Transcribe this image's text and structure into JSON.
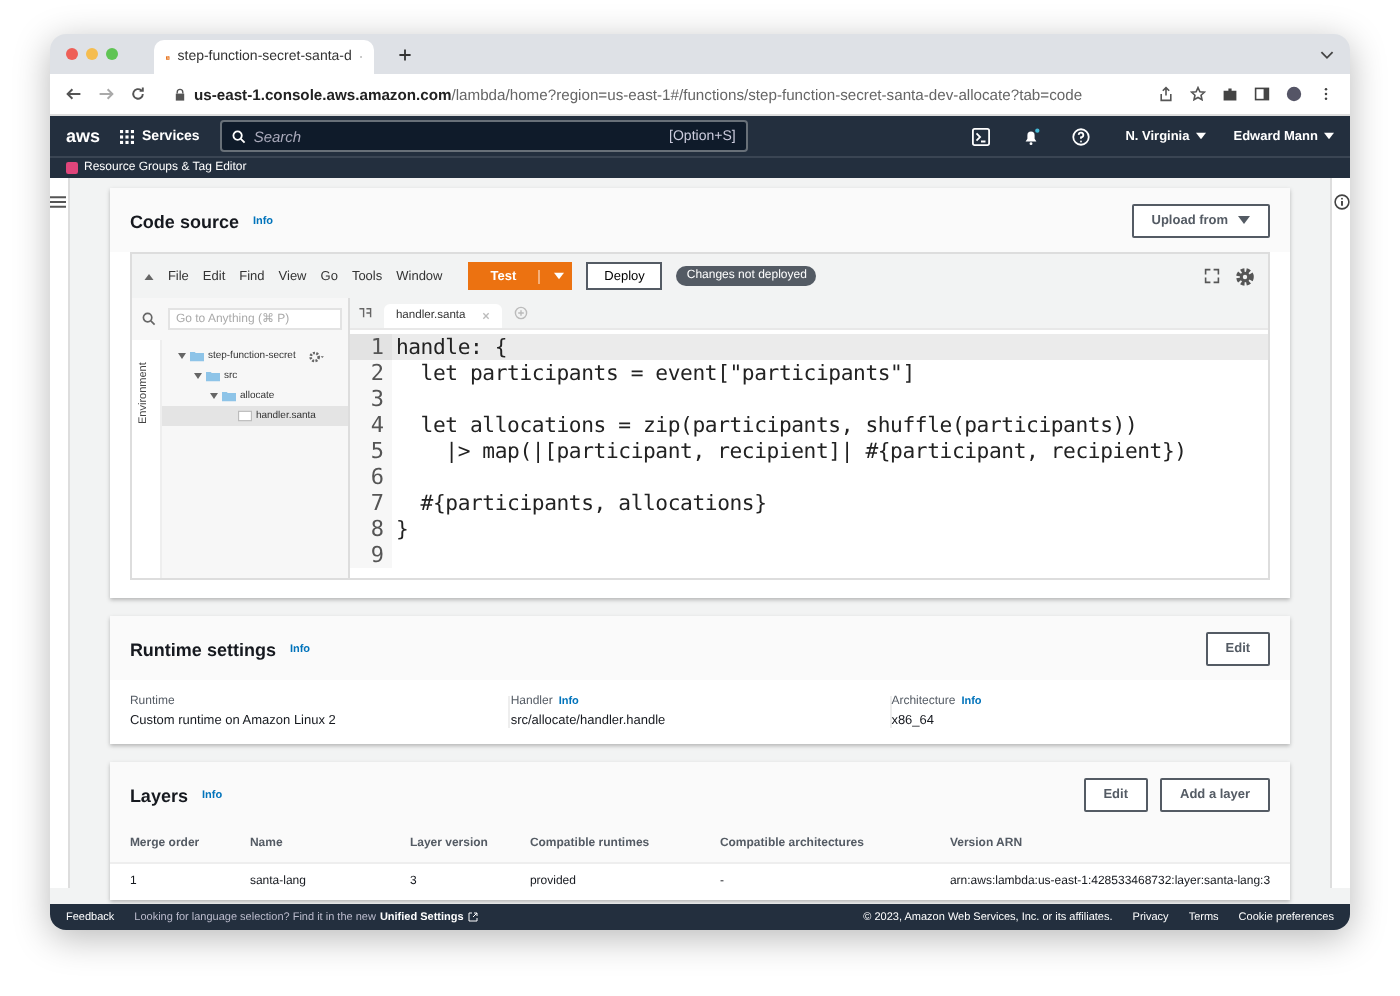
{
  "browser": {
    "tab_title": "step-function-secret-santa-d",
    "url_host": "us-east-1.console.aws.amazon.com",
    "url_path": "/lambda/home?region=us-east-1#/functions/step-function-secret-santa-dev-allocate?tab=code"
  },
  "aws_nav": {
    "logo": "aws",
    "services": "Services",
    "search_placeholder": "Search",
    "search_shortcut": "[Option+S]",
    "region": "N. Virginia",
    "user": "Edward Mann",
    "favorite": "Resource Groups & Tag Editor"
  },
  "code_source": {
    "title": "Code source",
    "info": "Info",
    "upload": "Upload from",
    "menu": [
      "File",
      "Edit",
      "Find",
      "View",
      "Go",
      "Tools",
      "Window"
    ],
    "test": "Test",
    "deploy": "Deploy",
    "status_badge": "Changes not deployed",
    "goto_placeholder": "Go to Anything (⌘ P)",
    "env_label": "Environment",
    "tree": [
      {
        "name": "step-function-secret",
        "kind": "folder",
        "expanded": true,
        "selected": false,
        "children": [
          {
            "name": "src",
            "kind": "folder",
            "expanded": true,
            "selected": false,
            "children": [
              {
                "name": "allocate",
                "kind": "folder",
                "expanded": true,
                "selected": false,
                "children": [
                  {
                    "name": "handler.santa",
                    "kind": "file",
                    "selected": true
                  }
                ]
              }
            ]
          }
        ]
      }
    ],
    "editor_tab": "handler.santa",
    "lines": [
      {
        "num": "1",
        "text": "handle: {",
        "active": true
      },
      {
        "num": "2",
        "text": "  let participants = event[\"participants\"]",
        "active": false
      },
      {
        "num": "3",
        "active": false
      },
      {
        "num": "4",
        "text": "  let allocations = zip(participants, shuffle(participants))",
        "active": false
      },
      {
        "num": "5",
        "text": "    |> map(|[participant, recipient]| #{participant, recipient})",
        "active": false
      },
      {
        "num": "6",
        "active": false
      },
      {
        "num": "7",
        "text": "  #{participants, allocations}",
        "active": false
      },
      {
        "num": "8",
        "text": "}",
        "active": false
      },
      {
        "num": "9",
        "active": false
      }
    ]
  },
  "runtime_settings": {
    "title": "Runtime settings",
    "info": "Info",
    "edit": "Edit",
    "fields": [
      {
        "label": "Runtime",
        "value": "Custom runtime on Amazon Linux 2"
      },
      {
        "label": "Handler",
        "info": "Info",
        "value": "src/allocate/handler.handle"
      },
      {
        "label": "Architecture",
        "info": "Info",
        "value": "x86_64"
      }
    ]
  },
  "layers": {
    "title": "Layers",
    "info": "Info",
    "edit": "Edit",
    "add": "Add a layer",
    "columns": [
      "Merge order",
      "Name",
      "Layer version",
      "Compatible runtimes",
      "Compatible architectures",
      "Version ARN"
    ],
    "rows": [
      [
        "1",
        "santa-lang",
        "3",
        "provided",
        "-",
        "arn:aws:lambda:us-east-1:428533468732:layer:santa-lang:3"
      ]
    ]
  },
  "footer": {
    "feedback": "Feedback",
    "notice": "Looking for language selection? Find it in the new",
    "notice_link": "Unified Settings",
    "copyright": "© 2023, Amazon Web Services, Inc. or its affiliates.",
    "links": [
      "Privacy",
      "Terms",
      "Cookie preferences"
    ]
  }
}
